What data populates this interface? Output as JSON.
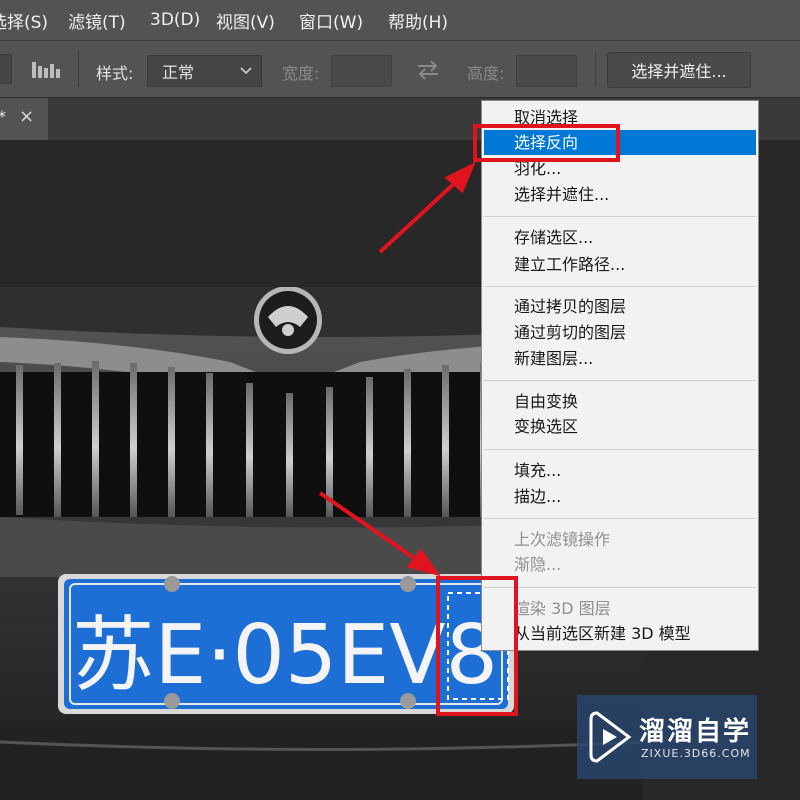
{
  "menubar": {
    "items": [
      "选择(S)",
      "滤镜(T)",
      "3D(D)",
      "视图(V)",
      "窗口(W)",
      "帮助(H)"
    ]
  },
  "options": {
    "style_label": "样式:",
    "style_value": "正常",
    "width_label": "宽度:",
    "height_label": "高度:",
    "select_and_mask_button": "选择并遮住..."
  },
  "tab": {
    "title_suffix": "*",
    "close_glyph": "×"
  },
  "context_menu": {
    "items": [
      {
        "label": "取消选择"
      },
      {
        "label": "选择反向"
      },
      {
        "label": "羽化..."
      },
      {
        "label": "选择并遮住..."
      },
      {
        "label": "存储选区..."
      },
      {
        "label": "建立工作路径..."
      },
      {
        "label": "通过拷贝的图层"
      },
      {
        "label": "通过剪切的图层"
      },
      {
        "label": "新建图层..."
      },
      {
        "label": "自由变换"
      },
      {
        "label": "变换选区"
      },
      {
        "label": "填充..."
      },
      {
        "label": "描边..."
      },
      {
        "label": "上次滤镜操作"
      },
      {
        "label": "渐隐..."
      },
      {
        "label": "渲染 3D 图层"
      },
      {
        "label": "从当前选区新建 3D 模型"
      }
    ]
  },
  "photo": {
    "plate_text": "苏E·05EV8"
  },
  "watermark": {
    "brand": "溜溜自学",
    "url": "ZIXUE.3D66.COM"
  },
  "colors": {
    "menu_highlight": "#0078d7",
    "annotation_red": "#e0141e",
    "plate_blue": "#1d6fd6"
  }
}
